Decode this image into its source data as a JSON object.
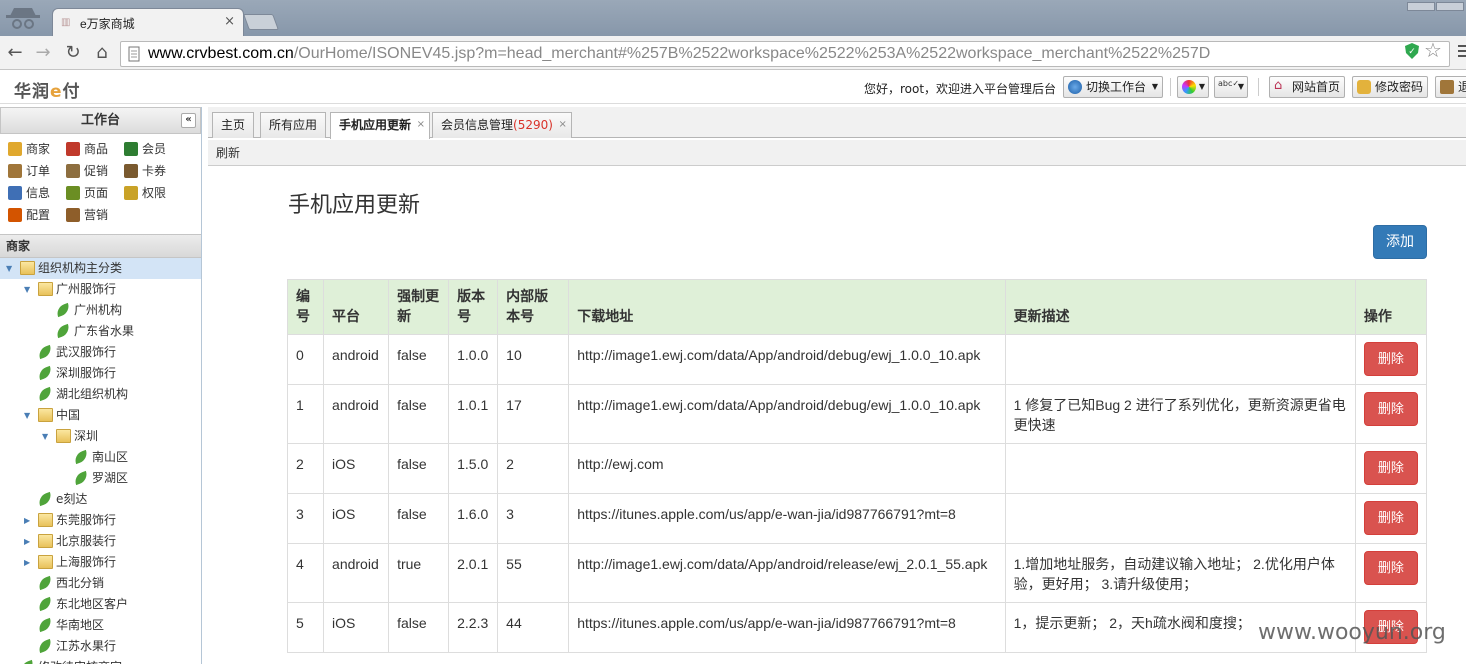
{
  "browser": {
    "tab_title": "e万家商城",
    "tab_close": "×",
    "url_host": "www.crvbest.com.cn",
    "url_path": "/OurHome/ISONEV45.jsp?m=head_merchant#%257B%2522workspace%2522%253A%2522workspace_merchant%2522%257D"
  },
  "header": {
    "logo_text": "华润",
    "logo_accent": "e",
    "logo_suffix": "付",
    "welcome": "您好，root，欢迎进入平台管理后台",
    "switch_workspace": "切换工作台",
    "home_site": "网站首页",
    "change_password": "修改密码",
    "exit": "退"
  },
  "sidebar": {
    "title": "工作台",
    "collapse": "«",
    "modules": [
      {
        "label": "商家",
        "icon": "crown-icon"
      },
      {
        "label": "商品",
        "icon": "goods-icon"
      },
      {
        "label": "会员",
        "icon": "members-icon"
      },
      {
        "label": "订单",
        "icon": "order-icon"
      },
      {
        "label": "促销",
        "icon": "promo-icon"
      },
      {
        "label": "卡券",
        "icon": "card-icon"
      },
      {
        "label": "信息",
        "icon": "info-icon"
      },
      {
        "label": "页面",
        "icon": "page-icon"
      },
      {
        "label": "权限",
        "icon": "key-icon"
      },
      {
        "label": "配置",
        "icon": "config-icon"
      },
      {
        "label": "营销",
        "icon": "marketing-icon"
      }
    ],
    "section": "商家",
    "tree": [
      {
        "label": "组织机构主分类",
        "level": 0,
        "type": "folder",
        "expanded": true,
        "selected": true
      },
      {
        "label": "广州服饰行",
        "level": 1,
        "type": "folder",
        "expanded": true
      },
      {
        "label": "广州机构",
        "level": 2,
        "type": "leaf"
      },
      {
        "label": "广东省水果",
        "level": 2,
        "type": "leaf"
      },
      {
        "label": "武汉服饰行",
        "level": 1,
        "type": "leaf"
      },
      {
        "label": "深圳服饰行",
        "level": 1,
        "type": "leaf"
      },
      {
        "label": "湖北组织机构",
        "level": 1,
        "type": "leaf"
      },
      {
        "label": "中国",
        "level": 1,
        "type": "folder",
        "expanded": true
      },
      {
        "label": "深圳",
        "level": 2,
        "type": "folder",
        "expanded": true
      },
      {
        "label": "南山区",
        "level": 3,
        "type": "leaf"
      },
      {
        "label": "罗湖区",
        "level": 3,
        "type": "leaf"
      },
      {
        "label": "e刻达",
        "level": 1,
        "type": "leaf"
      },
      {
        "label": "东莞服饰行",
        "level": 1,
        "type": "folder",
        "expanded": false
      },
      {
        "label": "北京服装行",
        "level": 1,
        "type": "folder",
        "expanded": false
      },
      {
        "label": "上海服饰行",
        "level": 1,
        "type": "folder",
        "expanded": false
      },
      {
        "label": "西北分销",
        "level": 1,
        "type": "leaf"
      },
      {
        "label": "东北地区客户",
        "level": 1,
        "type": "leaf"
      },
      {
        "label": "华南地区",
        "level": 1,
        "type": "leaf"
      },
      {
        "label": "江苏水果行",
        "level": 1,
        "type": "leaf"
      },
      {
        "label": "修改待审核商家",
        "level": 0,
        "type": "leaf"
      }
    ]
  },
  "content": {
    "tabs": [
      {
        "label": "主页",
        "closable": false,
        "active": false
      },
      {
        "label": "所有应用",
        "closable": false,
        "active": false
      },
      {
        "label": "手机应用更新",
        "closable": true,
        "active": true
      },
      {
        "label": "会员信息管理",
        "count": "(5290)",
        "closable": true,
        "active": false
      }
    ],
    "close_glyph": "×",
    "refresh": "刷新",
    "page_title": "手机应用更新",
    "add_button": "添加",
    "table": {
      "headers": [
        "编号",
        "平台",
        "强制更新",
        "版本号",
        "内部版本号",
        "下载地址",
        "更新描述",
        "操作"
      ],
      "delete_label": "删除",
      "rows": [
        {
          "id": "0",
          "platform": "android",
          "force": "false",
          "version": "1.0.0",
          "build": "10",
          "url": "http://image1.ewj.com/data/App/android/debug/ewj_1.0.0_10.apk",
          "desc": ""
        },
        {
          "id": "1",
          "platform": "android",
          "force": "false",
          "version": "1.0.1",
          "build": "17",
          "url": "http://image1.ewj.com/data/App/android/debug/ewj_1.0.0_10.apk",
          "desc": "1 修复了已知Bug 2 进行了系列优化，更新资源更省电更快速"
        },
        {
          "id": "2",
          "platform": "iOS",
          "force": "false",
          "version": "1.5.0",
          "build": "2",
          "url": "http://ewj.com",
          "desc": ""
        },
        {
          "id": "3",
          "platform": "iOS",
          "force": "false",
          "version": "1.6.0",
          "build": "3",
          "url": "https://itunes.apple.com/us/app/e-wan-jia/id987766791?mt=8",
          "desc": ""
        },
        {
          "id": "4",
          "platform": "android",
          "force": "true",
          "version": "2.0.1",
          "build": "55",
          "url": "http://image1.ewj.com/data/App/android/release/ewj_2.0.1_55.apk",
          "desc": "1.增加地址服务，自动建议输入地址； 2.优化用户体验，更好用； 3.请升级使用；"
        },
        {
          "id": "5",
          "platform": "iOS",
          "force": "false",
          "version": "2.2.3",
          "build": "44",
          "url": "https://itunes.apple.com/us/app/e-wan-jia/id987766791?mt=8",
          "desc": "1，提示更新； 2，天h疏水阀和度搜；"
        }
      ]
    }
  },
  "watermark": "www.wooyun.org",
  "colors": {
    "primary": "#337ab7",
    "danger": "#d9534f",
    "header_bg": "#dff0d8",
    "tree_selected": "#d3e4f6"
  }
}
